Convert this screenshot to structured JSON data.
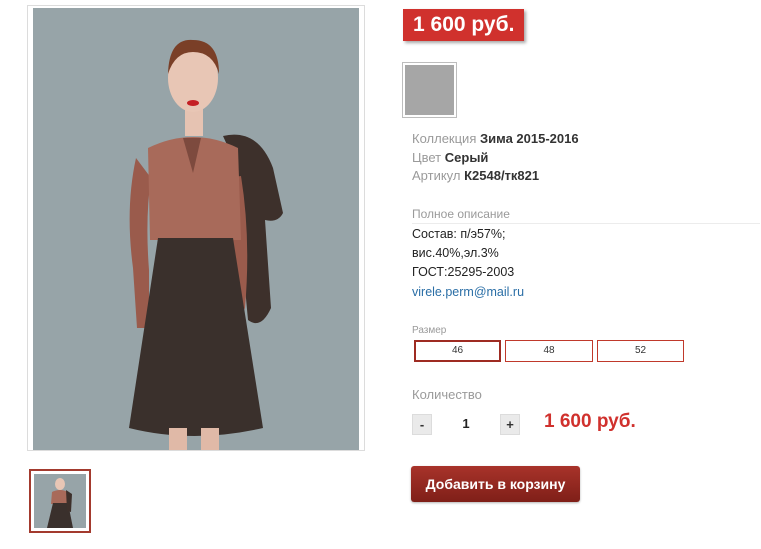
{
  "product": {
    "price_badge": "1 600 руб.",
    "color_swatch": "#a6a6a6",
    "collection": {
      "label": "Коллекция",
      "value": "Зима 2015-2016"
    },
    "color": {
      "label": "Цвет",
      "value": "Серый"
    },
    "article": {
      "label": "Артикул",
      "value": "К2548/тк821"
    }
  },
  "description": {
    "heading": "Полное описание",
    "lines": [
      "Состав: п/э57%;",
      "вис.40%,эл.3%",
      "ГОСТ:25295-2003"
    ],
    "email": "virele.perm@mail.ru"
  },
  "sizes": {
    "label": "Размер",
    "options": [
      "46",
      "48",
      "52"
    ],
    "selected": "46"
  },
  "quantity": {
    "label": "Количество",
    "minus": "-",
    "value": "1",
    "plus": "+"
  },
  "total_price": "1 600 руб.",
  "add_to_cart": "Добавить в корзину",
  "colors": {
    "accent": "#d0312d",
    "button": "#8f2820",
    "link": "#2a6ea6",
    "photo_background": "#97a4a8"
  }
}
